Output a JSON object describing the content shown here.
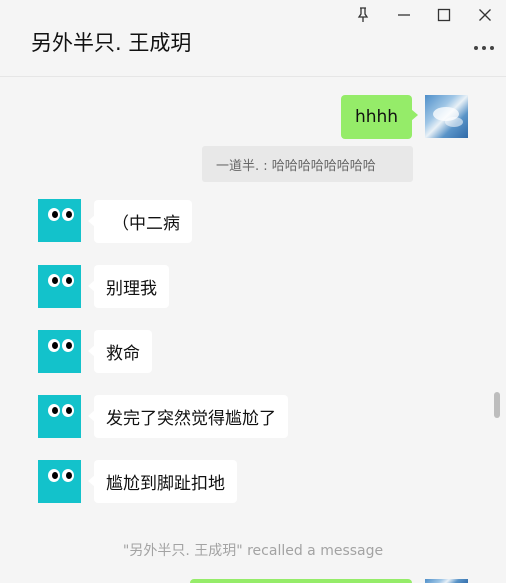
{
  "window": {
    "title": "另外半只. 王成玥",
    "controls": {
      "pin_icon": "pin-icon",
      "minimize_icon": "minimize-icon",
      "maximize_icon": "maximize-icon",
      "close_icon": "close-icon",
      "more_icon": "more-icon"
    }
  },
  "colors": {
    "sent_bubble": "#95ec69",
    "received_bubble": "#ffffff",
    "contact_avatar": "#13c2cb",
    "background": "#f5f5f5"
  },
  "messages": [
    {
      "side": "right",
      "text": "hhhh"
    },
    {
      "type": "quote",
      "text": "一道半. : 哈哈哈哈哈哈哈哈"
    },
    {
      "side": "left",
      "text": "（中二病"
    },
    {
      "side": "left",
      "text": "别理我"
    },
    {
      "side": "left",
      "text": "救命"
    },
    {
      "side": "left",
      "text": "发完了突然觉得尴尬了"
    },
    {
      "side": "left",
      "text": "尴尬到脚趾扣地"
    },
    {
      "type": "system",
      "text": "\"另外半只. 王成玥\" recalled a message"
    }
  ]
}
